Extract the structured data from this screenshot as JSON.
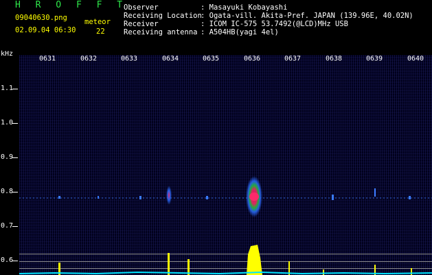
{
  "header": {
    "app_title": "H R O F F T",
    "filename": "09040630.png",
    "datetime": "02.09.04 06:30",
    "meteor_label": "meteor",
    "meteor_count": "22",
    "fields": [
      {
        "label": "Observer",
        "value": ": Masayuki Kobayashi"
      },
      {
        "label": "Receiving Location",
        "value": ": Ogata-vill. Akita-Pref. JAPAN (139.96E, 40.02N)"
      },
      {
        "label": "Receiver",
        "value": ": ICOM IC-575 53.7492(@LCD)MHz USB"
      },
      {
        "label": "Receiving antenna",
        "value": ": A504HB(yagi 4el)"
      }
    ]
  },
  "spectrogram": {
    "unit_label": "kHz",
    "y_labels": [
      "1.1",
      "1.0",
      "0.9",
      "0.8",
      "0.7",
      "0.6"
    ],
    "hour_ticks": [
      "0631",
      "0632",
      "0633",
      "0634",
      "0635",
      "0636",
      "0637",
      "0638",
      "0639",
      "0640"
    ]
  },
  "colors": {
    "title": "#2ee84a",
    "text_yellow": "#ffff00",
    "background": "#01011c",
    "echo_core": "#ff2a6a",
    "echo_halo": "#2a6bff",
    "activity_bar": "#ffff00",
    "baseline": "#00e5ff"
  }
}
